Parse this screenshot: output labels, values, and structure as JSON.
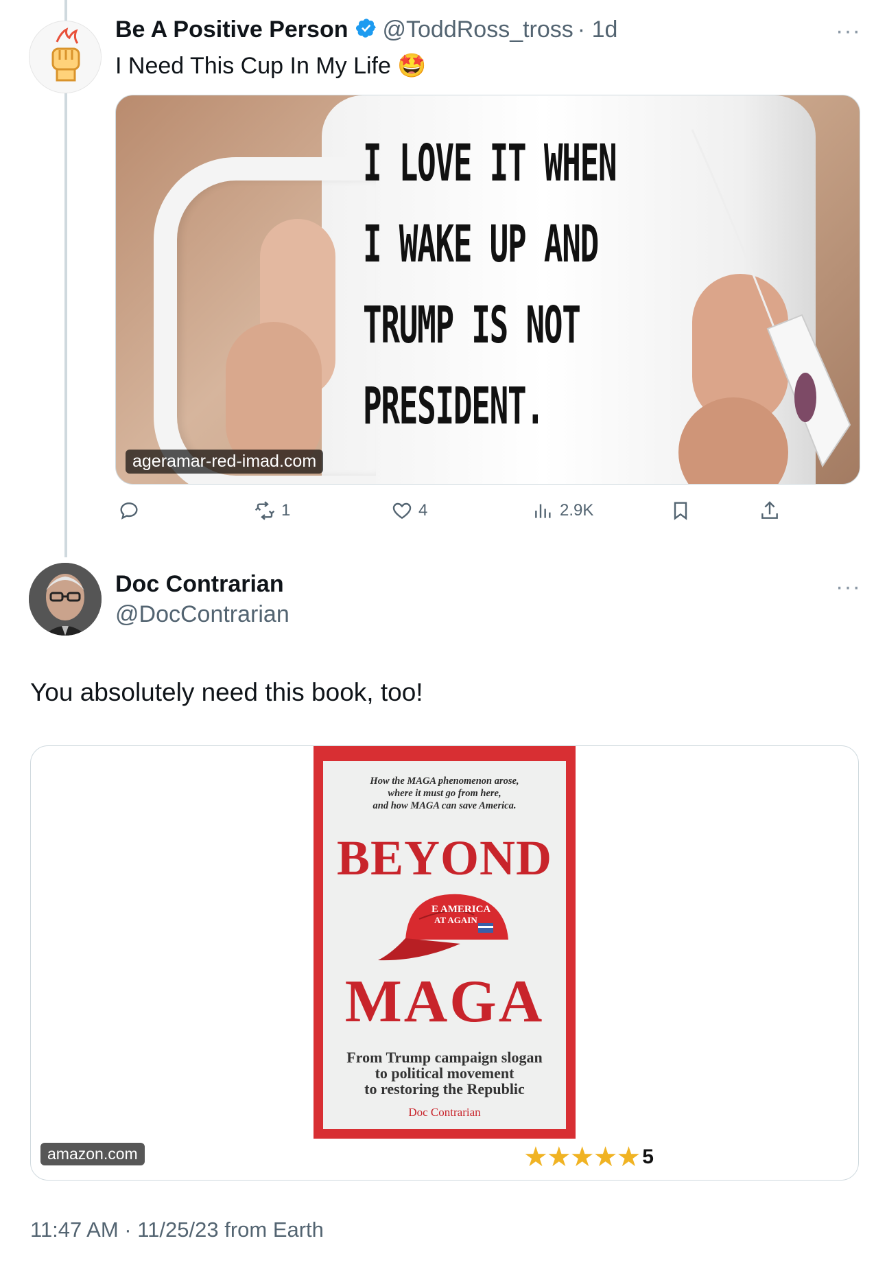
{
  "tweet1": {
    "name": "Be A Positive Person",
    "handle": "@ToddRoss_tross",
    "time": "· 1d",
    "text": "I Need This Cup In My Life",
    "emoji": "🤩",
    "avatar_icon": "fist-flame-icon",
    "media": {
      "mug_lines": [
        "I LOVE IT WHEN",
        "I WAKE UP AND",
        "TRUMP IS NOT",
        "PRESIDENT."
      ],
      "domain": "ageramar-red-imad.com"
    },
    "actions": {
      "reply": "",
      "retweet": "1",
      "like": "4",
      "views": "2.9K"
    },
    "more": "···"
  },
  "tweet2": {
    "name": "Doc Contrarian",
    "handle": "@DocContrarian",
    "text": "You absolutely need this book, too!",
    "more": "···",
    "card": {
      "domain": "amazon.com",
      "book": {
        "tagline": [
          "How the MAGA phenomenon arose,",
          "where it must go from here,",
          "and how MAGA can save America."
        ],
        "title_top": "BEYOND",
        "title_bottom": "MAGA",
        "hat_text": [
          "E AMERICA",
          "AT AGAIN"
        ],
        "subtitle": [
          "From Trump campaign slogan",
          "to political movement",
          "to restoring the Republic"
        ],
        "author": "Doc Contrarian"
      },
      "stars": "★★★★★",
      "rating": "5"
    },
    "timestamp": "11:47 AM · 11/25/23 from Earth"
  },
  "colors": {
    "verified": "#1d9bf0",
    "secondary_text": "#536471",
    "book_red": "#c8242b",
    "star": "#f0b323"
  }
}
